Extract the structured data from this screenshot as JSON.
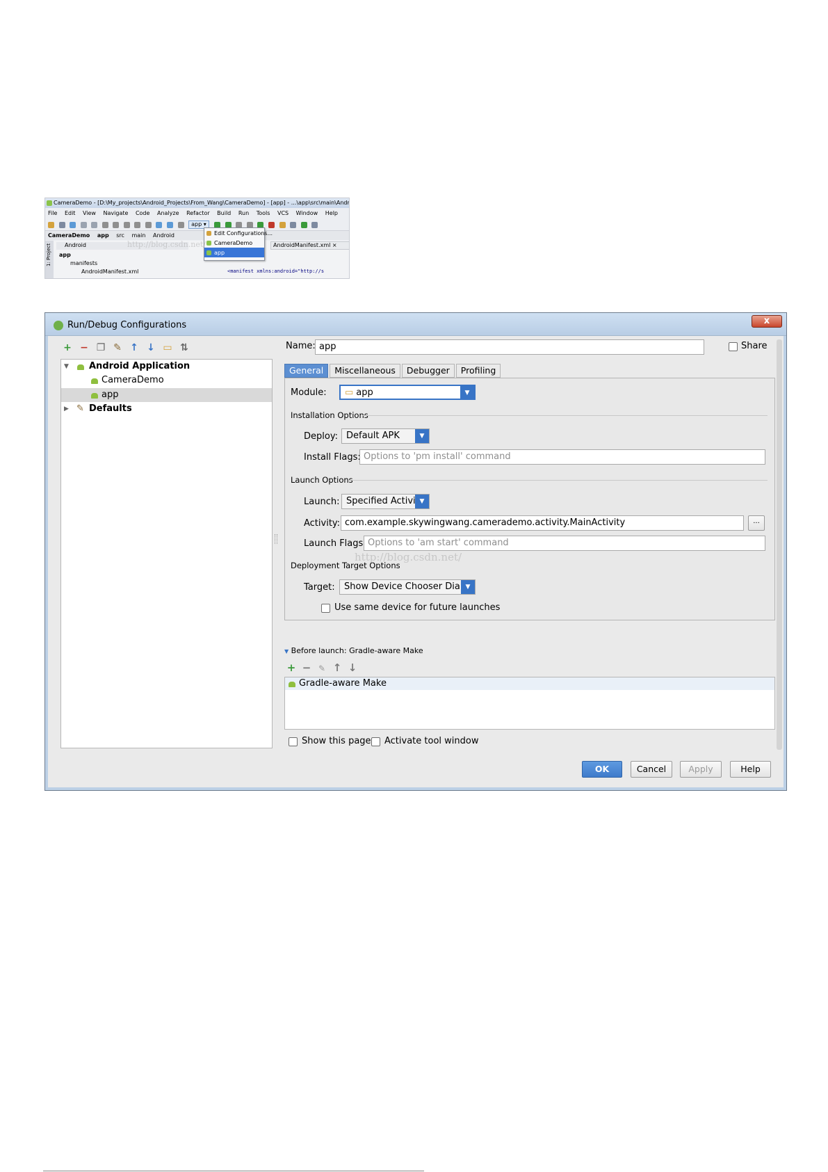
{
  "ide": {
    "title": "CameraDemo - [D:\\My_projects\\Android_Projects\\From_Wang\\CameraDemo] - [app] - ...\\app\\src\\main\\AndroidM",
    "menu": [
      "File",
      "Edit",
      "View",
      "Navigate",
      "Code",
      "Analyze",
      "Refactor",
      "Build",
      "Run",
      "Tools",
      "VCS",
      "Window",
      "Help"
    ],
    "run_config": "app",
    "breadcrumb": [
      "CameraDemo",
      "app",
      "src",
      "main",
      "Android"
    ],
    "project_view": "Android",
    "side_label": "1: Project",
    "tree": [
      "app",
      "manifests",
      "AndroidManifest.xml"
    ],
    "file_tab": "AndroidManifest.xml",
    "code_line": "<manifest xmlns:android=\"http://s",
    "dropdown": [
      "Edit Configurations...",
      "CameraDemo",
      "app"
    ],
    "watermark": "http://blog.csdn.net/"
  },
  "dialog": {
    "title": "Run/Debug Configurations",
    "close": "x",
    "toolbar_icons": [
      "add-icon",
      "remove-icon",
      "copy-icon",
      "wrench-icon",
      "arrow-up-icon",
      "arrow-down-icon",
      "folder-icon",
      "sort-icon"
    ],
    "tree": {
      "group": "Android Application",
      "items": [
        "CameraDemo",
        "app"
      ],
      "defaults": "Defaults"
    },
    "name_label": "Name:",
    "name_value": "app",
    "share_label": "Share",
    "tabs": [
      "General",
      "Miscellaneous",
      "Debugger",
      "Profiling"
    ],
    "module_label": "Module:",
    "module_value": "app",
    "installation_options": "Installation Options",
    "deploy_label": "Deploy:",
    "deploy_value": "Default APK",
    "install_flags_label": "Install Flags:",
    "install_flags_placeholder": "Options to 'pm install' command",
    "launch_options": "Launch Options",
    "launch_label": "Launch:",
    "launch_value": "Specified Activity",
    "activity_label": "Activity:",
    "activity_value": "com.example.skywingwang.camerademo.activity.MainActivity",
    "browse_label": "...",
    "launch_flags_label": "Launch Flags:",
    "launch_flags_placeholder": "Options to 'am start' command",
    "deployment_target_options": "Deployment Target Options",
    "target_label": "Target:",
    "target_value": "Show Device Chooser Dialog",
    "same_device_label": "Use same device for future launches",
    "before_launch_label": "Before launch: Gradle-aware Make",
    "before_launch_item": "Gradle-aware Make",
    "show_page_label": "Show this page",
    "activate_tool_label": "Activate tool window",
    "buttons": {
      "ok": "OK",
      "cancel": "Cancel",
      "apply": "Apply",
      "help": "Help"
    },
    "watermark": "http://blog.csdn.net/"
  },
  "colors": {
    "accent": "#3874c6",
    "android_green": "#8fbf3f",
    "add_green": "#3a9a3a",
    "remove_red": "#c0392b"
  }
}
